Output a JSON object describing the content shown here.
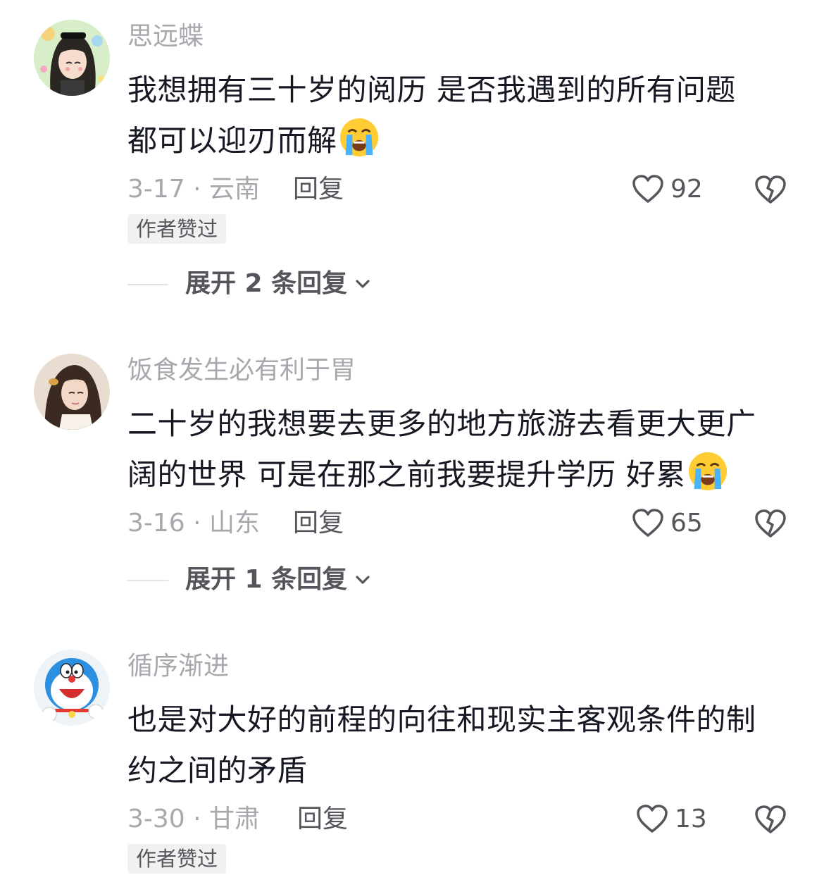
{
  "comments": [
    {
      "username": "思远蝶",
      "lines": [
        "我想拥有三十岁的阅历  是否我遇到的所有问题",
        "都可以迎刃而解"
      ],
      "emoji": "loudly-crying-face",
      "date_location": "3-17 · 云南",
      "reply_label": "回复",
      "likes": "92",
      "badge": "作者赞过",
      "expand_label": "展开 2 条回复"
    },
    {
      "username": "饭食发生必有利于胃",
      "lines": [
        "二十岁的我想要去更多的地方旅游去看更大更广",
        "阔的世界 可是在那之前我要提升学历 好累"
      ],
      "emoji": "loudly-crying-face",
      "date_location": "3-16 · 山东",
      "reply_label": "回复",
      "likes": "65",
      "badge": "",
      "expand_label": "展开 1 条回复"
    },
    {
      "username": "循序渐进",
      "lines": [
        "也是对大好的前程的向往和现实主客观条件的制",
        "约之间的矛盾"
      ],
      "emoji": "",
      "date_location": "3-30 · 甘肃",
      "reply_label": "回复",
      "likes": "13",
      "badge": "作者赞过",
      "expand_label": ""
    }
  ],
  "icons": {
    "like": "heart-outline-icon",
    "dislike": "broken-heart-icon",
    "expand": "chevron-down-icon"
  },
  "colors": {
    "text_primary": "#161823",
    "text_secondary": "#a7a8ad",
    "text_action": "#55565c",
    "badge_bg": "#f1f1f2"
  }
}
